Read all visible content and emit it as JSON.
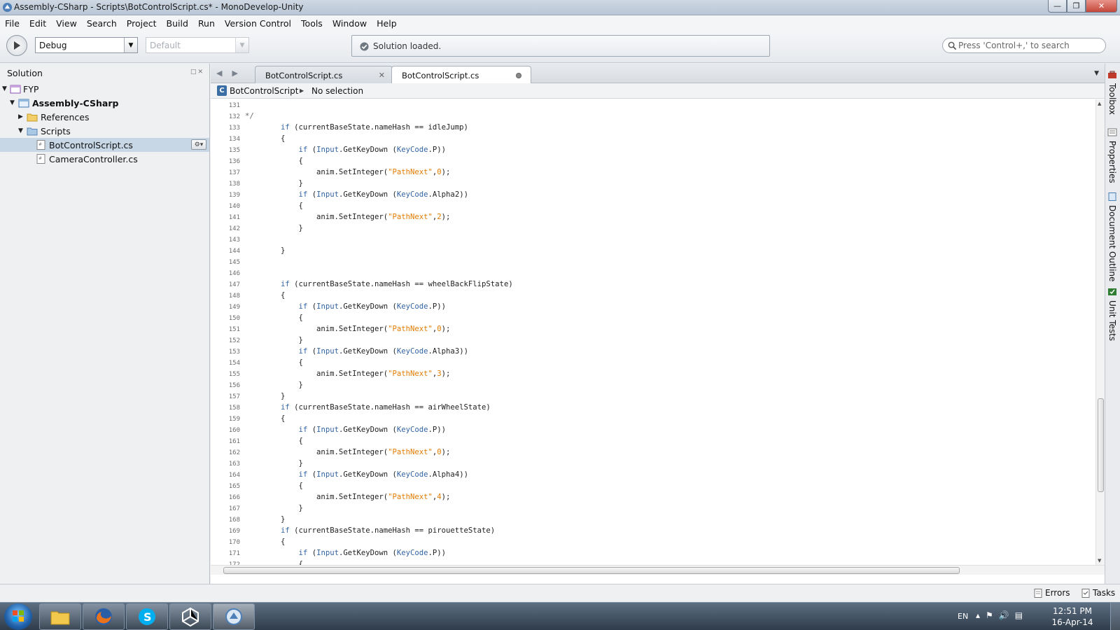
{
  "window": {
    "title": "Assembly-CSharp - Scripts\\BotControlScript.cs* - MonoDevelop-Unity",
    "buttons": [
      "minimize",
      "maximize",
      "close"
    ]
  },
  "menubar": [
    "File",
    "Edit",
    "View",
    "Search",
    "Project",
    "Build",
    "Run",
    "Version Control",
    "Tools",
    "Window",
    "Help"
  ],
  "toolbar": {
    "configuration": "Debug",
    "platform": "Default",
    "status_message": "Solution loaded.",
    "search_placeholder": "Press 'Control+,' to search"
  },
  "solution": {
    "pad_title": "Solution",
    "tree": [
      {
        "label": "FYP",
        "level": 0,
        "expanded": true,
        "icon": "solution-icon"
      },
      {
        "label": "Assembly-CSharp",
        "level": 1,
        "expanded": true,
        "icon": "project-icon",
        "bold": true
      },
      {
        "label": "References",
        "level": 2,
        "expanded": false,
        "icon": "folder-icon"
      },
      {
        "label": "Scripts",
        "level": 2,
        "expanded": true,
        "icon": "folder-icon"
      },
      {
        "label": "BotControlScript.cs",
        "level": 3,
        "icon": "file-icon",
        "selected": true
      },
      {
        "label": "CameraController.cs",
        "level": 3,
        "icon": "file-icon"
      }
    ]
  },
  "editor": {
    "tabs": [
      {
        "label": "BotControlScript.cs",
        "active": false
      },
      {
        "label": "BotControlScript.cs",
        "active": true,
        "modified": true
      }
    ],
    "breadcrumb": {
      "class_name": "BotControlScript",
      "member": "No selection"
    },
    "lines": [
      {
        "n": "131",
        "html": ""
      },
      {
        "n": "132",
        "html": "<span class=\"cm\">*/</span>"
      },
      {
        "n": "133",
        "html": "        <span class=\"kw\">if</span> (currentBaseState.nameHash == idleJump)"
      },
      {
        "n": "134",
        "html": "        {"
      },
      {
        "n": "135",
        "html": "            <span class=\"kw\">if</span> (<span class=\"ty\">Input</span>.GetKeyDown (<span class=\"ty\">KeyCode</span>.P))"
      },
      {
        "n": "136",
        "html": "            {"
      },
      {
        "n": "137",
        "html": "                anim.SetInteger(<span class=\"st\">\"PathNext\"</span>,<span class=\"nm\">0</span>);"
      },
      {
        "n": "138",
        "html": "            }"
      },
      {
        "n": "139",
        "html": "            <span class=\"kw\">if</span> (<span class=\"ty\">Input</span>.GetKeyDown (<span class=\"ty\">KeyCode</span>.Alpha2))"
      },
      {
        "n": "140",
        "html": "            {"
      },
      {
        "n": "141",
        "html": "                anim.SetInteger(<span class=\"st\">\"PathNext\"</span>,<span class=\"nm\">2</span>);"
      },
      {
        "n": "142",
        "html": "            }"
      },
      {
        "n": "143",
        "html": ""
      },
      {
        "n": "144",
        "html": "        }"
      },
      {
        "n": "145",
        "html": ""
      },
      {
        "n": "146",
        "html": ""
      },
      {
        "n": "147",
        "html": "        <span class=\"kw\">if</span> (currentBaseState.nameHash == wheelBackFlipState)"
      },
      {
        "n": "148",
        "html": "        {"
      },
      {
        "n": "149",
        "html": "            <span class=\"kw\">if</span> (<span class=\"ty\">Input</span>.GetKeyDown (<span class=\"ty\">KeyCode</span>.P))"
      },
      {
        "n": "150",
        "html": "            {"
      },
      {
        "n": "151",
        "html": "                anim.SetInteger(<span class=\"st\">\"PathNext\"</span>,<span class=\"nm\">0</span>);"
      },
      {
        "n": "152",
        "html": "            }"
      },
      {
        "n": "153",
        "html": "            <span class=\"kw\">if</span> (<span class=\"ty\">Input</span>.GetKeyDown (<span class=\"ty\">KeyCode</span>.Alpha3))"
      },
      {
        "n": "154",
        "html": "            {"
      },
      {
        "n": "155",
        "html": "                anim.SetInteger(<span class=\"st\">\"PathNext\"</span>,<span class=\"nm\">3</span>);"
      },
      {
        "n": "156",
        "html": "            }"
      },
      {
        "n": "157",
        "html": "        }"
      },
      {
        "n": "158",
        "html": "        <span class=\"kw\">if</span> (currentBaseState.nameHash == airWheelState)"
      },
      {
        "n": "159",
        "html": "        {"
      },
      {
        "n": "160",
        "html": "            <span class=\"kw\">if</span> (<span class=\"ty\">Input</span>.GetKeyDown (<span class=\"ty\">KeyCode</span>.P))"
      },
      {
        "n": "161",
        "html": "            {"
      },
      {
        "n": "162",
        "html": "                anim.SetInteger(<span class=\"st\">\"PathNext\"</span>,<span class=\"nm\">0</span>);"
      },
      {
        "n": "163",
        "html": "            }"
      },
      {
        "n": "164",
        "html": "            <span class=\"kw\">if</span> (<span class=\"ty\">Input</span>.GetKeyDown (<span class=\"ty\">KeyCode</span>.Alpha4))"
      },
      {
        "n": "165",
        "html": "            {"
      },
      {
        "n": "166",
        "html": "                anim.SetInteger(<span class=\"st\">\"PathNext\"</span>,<span class=\"nm\">4</span>);"
      },
      {
        "n": "167",
        "html": "            }"
      },
      {
        "n": "168",
        "html": "        }"
      },
      {
        "n": "169",
        "html": "        <span class=\"kw\">if</span> (currentBaseState.nameHash == pirouetteState)"
      },
      {
        "n": "170",
        "html": "        {"
      },
      {
        "n": "171",
        "html": "            <span class=\"kw\">if</span> (<span class=\"ty\">Input</span>.GetKeyDown (<span class=\"ty\">KeyCode</span>.P))"
      },
      {
        "n": "172",
        "html": "            {"
      }
    ]
  },
  "right_dock": [
    {
      "label": "Toolbox",
      "icon": "toolbox-icon"
    },
    {
      "label": "Properties",
      "icon": "properties-icon"
    },
    {
      "label": "Document Outline",
      "icon": "document-outline-icon"
    },
    {
      "label": "Unit Tests",
      "icon": "unit-tests-icon"
    }
  ],
  "statusbar": {
    "errors": "Errors",
    "tasks": "Tasks"
  },
  "taskbar": {
    "apps": [
      "explorer-icon",
      "firefox-icon",
      "skype-icon",
      "unity-icon",
      "monodevelop-icon"
    ],
    "language": "EN",
    "time": "12:51 PM",
    "date": "16-Apr-14"
  },
  "colors": {
    "keyword": "#3364a4",
    "string": "#e07b00",
    "selection": "#c7d7e6"
  }
}
